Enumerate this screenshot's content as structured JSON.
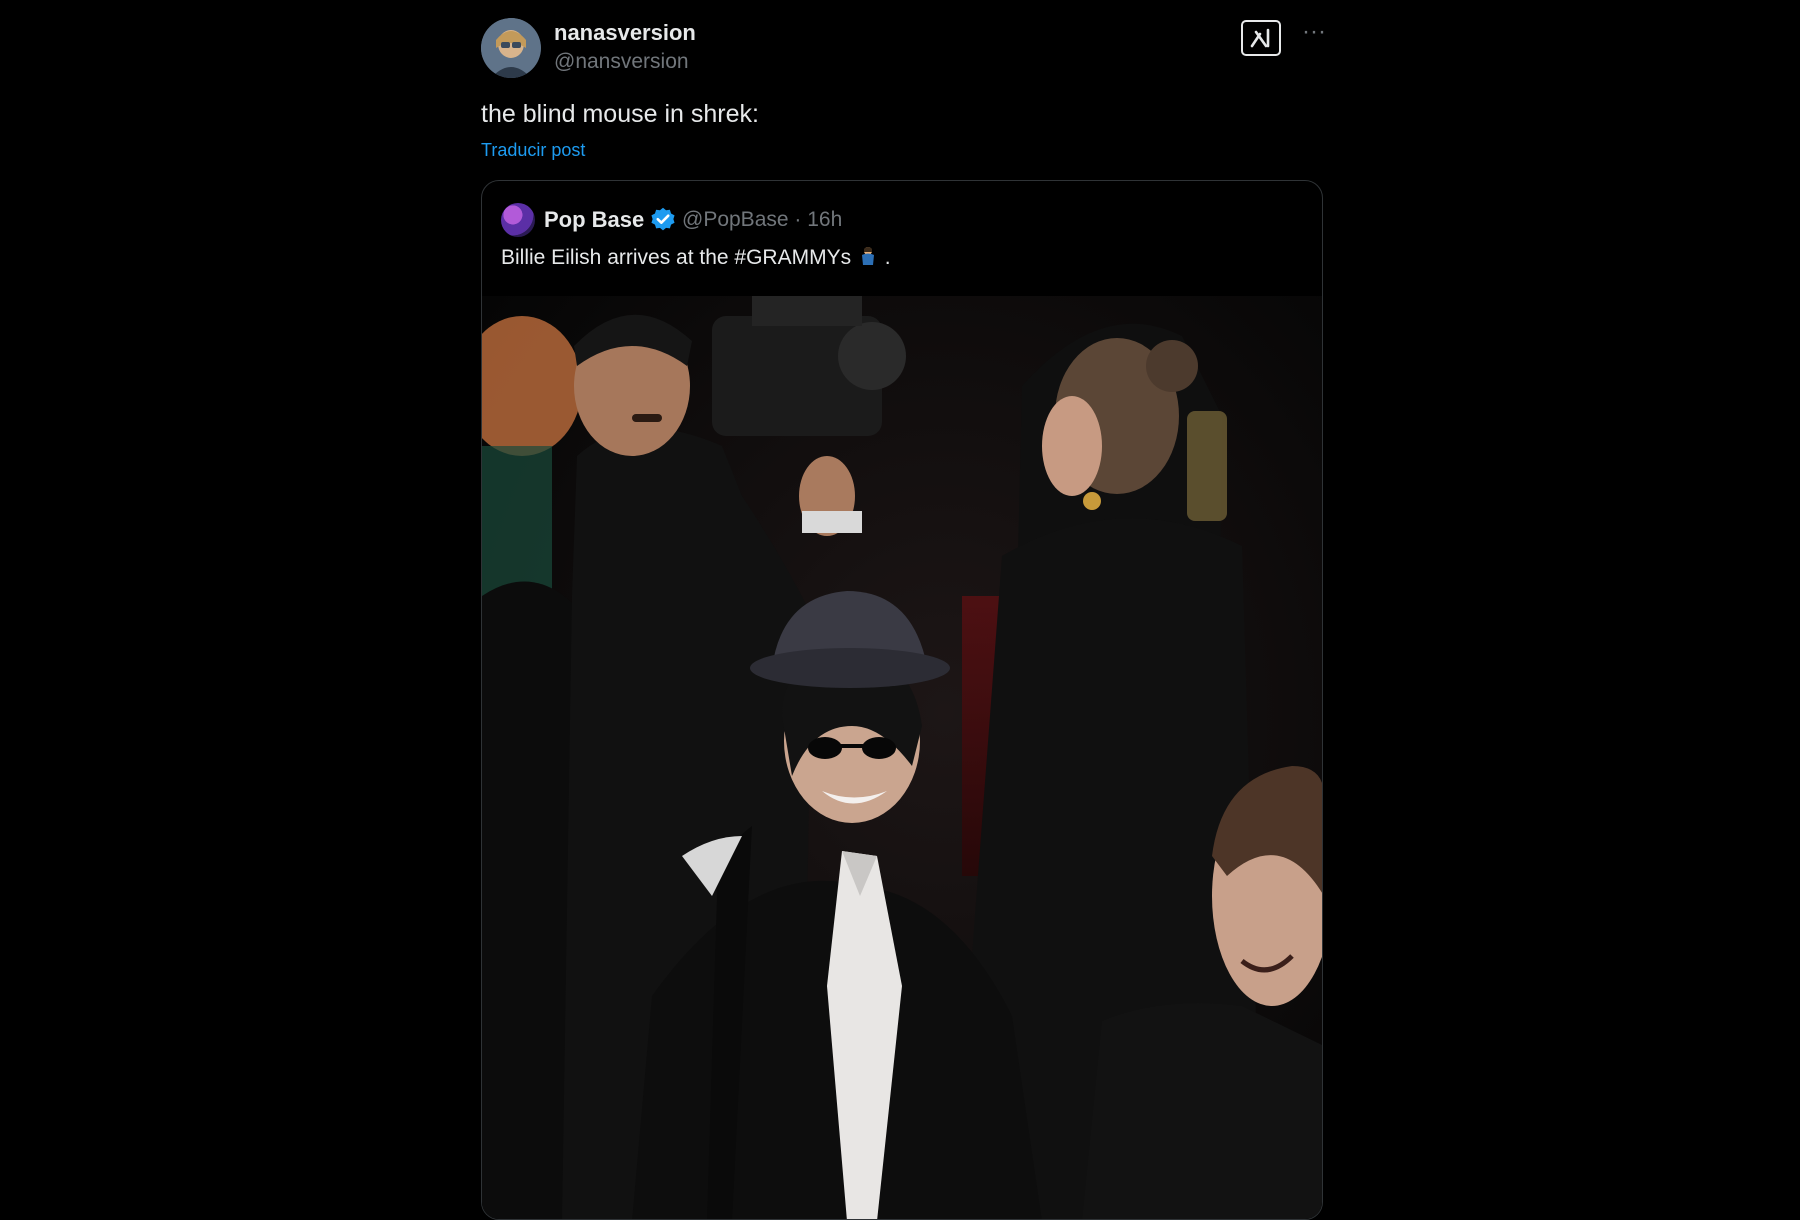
{
  "post": {
    "display_name": "nanasversion",
    "handle": "@nansversion",
    "text": "the blind mouse in shrek:",
    "translate_label": "Traducir post",
    "more_label": "···"
  },
  "quoted_post": {
    "display_name": "Pop Base",
    "handle_time": "@PopBase · 16h",
    "text": "Billie Eilish arrives at the #GRAMMYs",
    "text_suffix": ".",
    "media_alt": "photo"
  },
  "icons": {
    "avatar": "user-avatar",
    "grok": "grok-icon",
    "more": "more-options-icon",
    "verified": "verified-badge-icon",
    "emoji": "person-emoji-icon"
  },
  "colors": {
    "background": "#000000",
    "text_primary": "#e7e9ea",
    "text_secondary": "#71767b",
    "link": "#1d9bf0",
    "border": "#2f3336"
  }
}
